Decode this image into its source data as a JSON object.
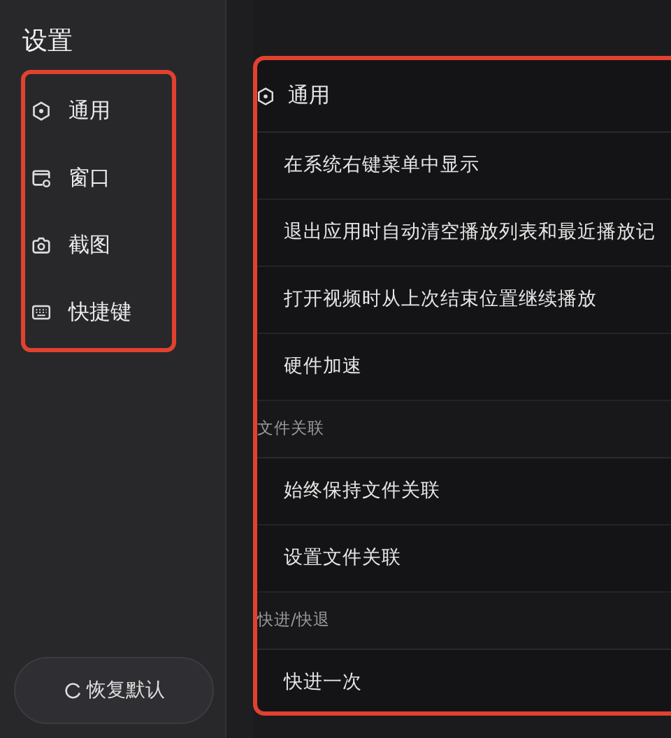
{
  "sidebar": {
    "title": "设置",
    "highlighted": true,
    "items": [
      {
        "label": "通用",
        "selected": false
      },
      {
        "label": "窗口",
        "selected": false
      },
      {
        "label": "截图",
        "selected": false
      },
      {
        "label": "快捷键",
        "selected": false
      }
    ],
    "reset_button": "恢复默认"
  },
  "content": {
    "highlighted": true,
    "header": {
      "label": "通用"
    },
    "rows": [
      {
        "kind": "item",
        "label": "在系统右键菜单中显示"
      },
      {
        "kind": "item",
        "label": "退出应用时自动清空播放列表和最近播放记"
      },
      {
        "kind": "item",
        "label": "打开视频时从上次结束位置继续播放"
      },
      {
        "kind": "item",
        "label": "硬件加速"
      },
      {
        "kind": "section",
        "label": "文件关联"
      },
      {
        "kind": "item",
        "label": "始终保持文件关联"
      },
      {
        "kind": "item",
        "label": "设置文件关联"
      },
      {
        "kind": "section",
        "label": "快进/快退"
      },
      {
        "kind": "item",
        "label": "快进一次"
      }
    ]
  }
}
